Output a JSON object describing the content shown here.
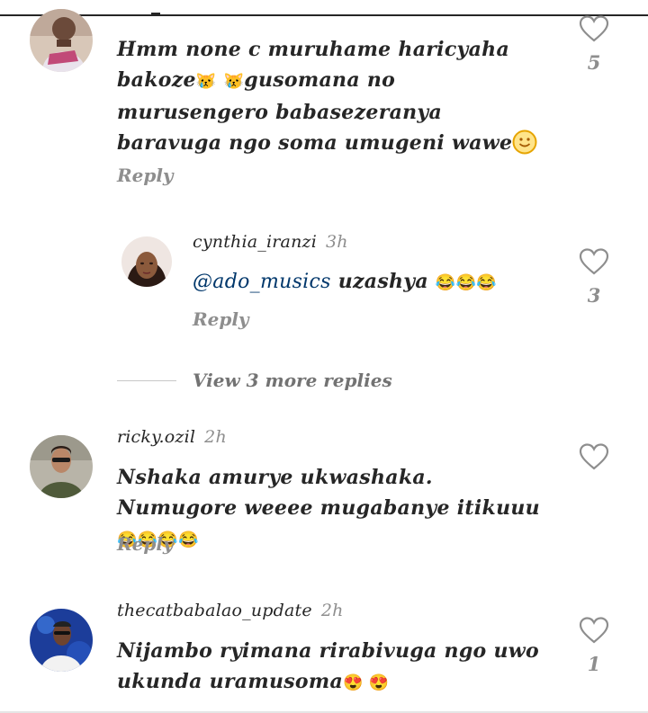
{
  "comments": [
    {
      "username": "",
      "time": "",
      "text_before": "Hmm none c muruhame haricyaha bakoze",
      "emoji1": "😿",
      "emoji2": "😿",
      "text_after": "gusomana no murusengero babasezeranya baravuga ngo soma umugeni wawe",
      "emoji_end": "🙂",
      "reply": "Reply",
      "likes": "5"
    },
    {
      "username": "cynthia_iranzi",
      "time": "3h",
      "mention": "@ado_musics",
      "text": "uzashya",
      "emojis": "😂😂😂",
      "reply": "Reply",
      "likes": "3"
    },
    {
      "username": "ricky.ozil",
      "time": "2h",
      "text": "Nshaka amurye ukwashaka.  Numugore weeee mugabanye itikuuu",
      "emojis": "😂😂😂😂",
      "reply": "Reply",
      "likes": ""
    },
    {
      "username": "thecatbabalao_update",
      "time": "2h",
      "text": "Nijambo ryimana rirabivuga ngo uwo ukunda uramusoma",
      "emojis": "😍 😍",
      "likes": "1"
    }
  ],
  "view_more": "View 3 more replies",
  "icons": {
    "heart": "heart-outline-icon"
  },
  "colors": {
    "text": "#262626",
    "muted": "#8e8e8e",
    "mention": "#00376b"
  }
}
